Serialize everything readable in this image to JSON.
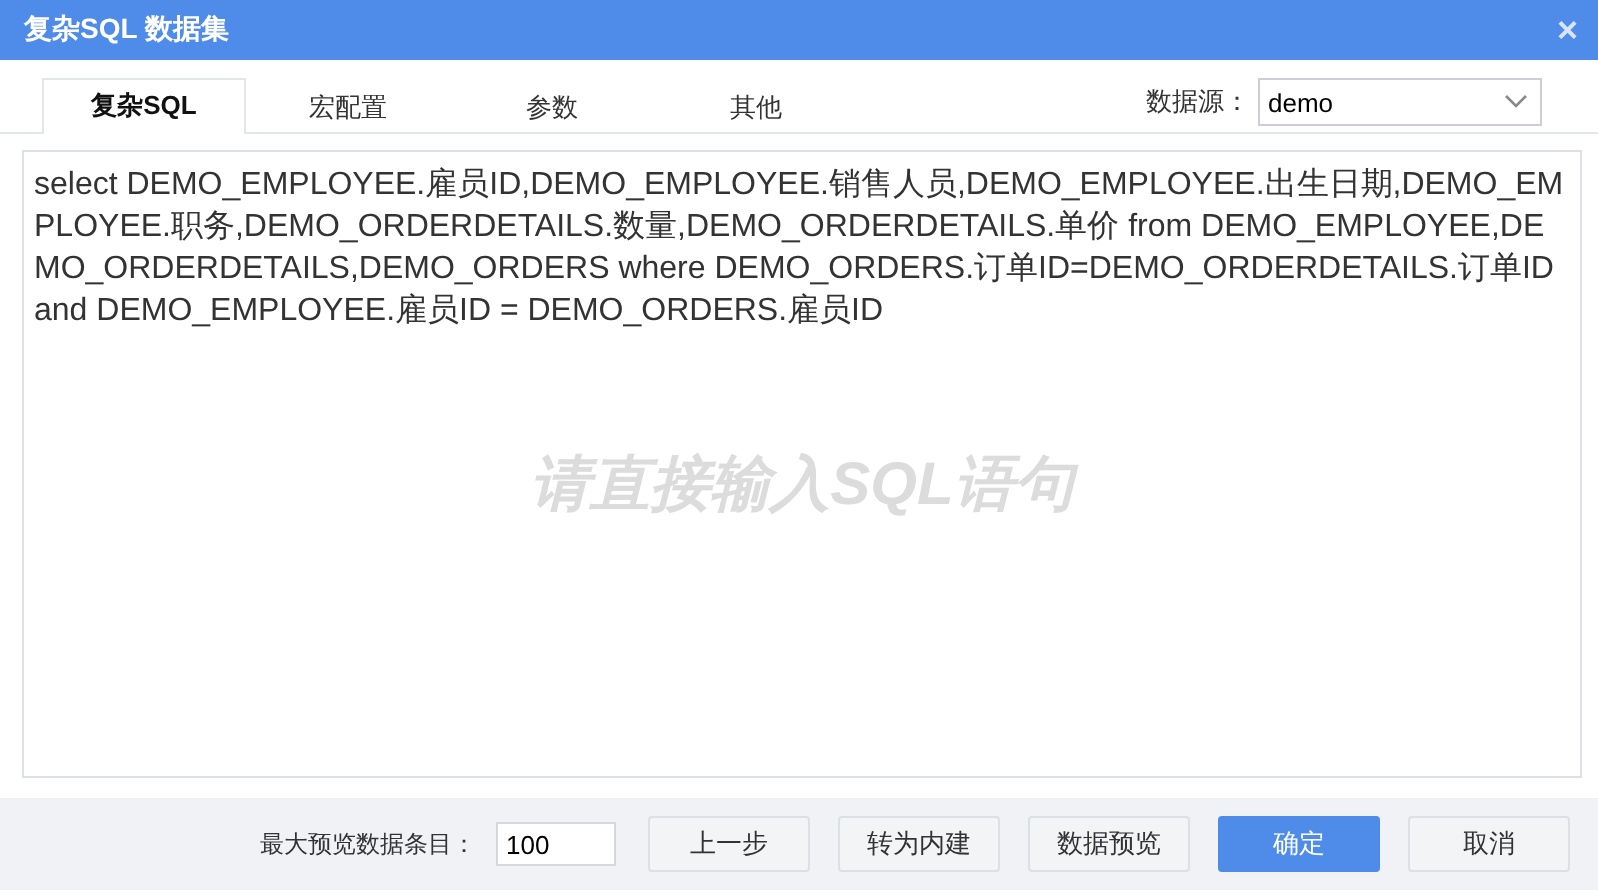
{
  "window": {
    "title": "复杂SQL 数据集",
    "close": "×"
  },
  "tabs": [
    {
      "label": "复杂SQL",
      "selected": true
    },
    {
      "label": "宏配置",
      "selected": false
    },
    {
      "label": "参数",
      "selected": false
    },
    {
      "label": "其他",
      "selected": false
    }
  ],
  "datasource": {
    "label": "数据源：",
    "value": "demo"
  },
  "editor": {
    "value": "select DEMO_EMPLOYEE.雇员ID,DEMO_EMPLOYEE.销售人员,DEMO_EMPLOYEE.出生日期,DEMO_EMPLOYEE.职务,DEMO_ORDERDETAILS.数量,DEMO_ORDERDETAILS.单价 from DEMO_EMPLOYEE,DEMO_ORDERDETAILS,DEMO_ORDERS where DEMO_ORDERS.订单ID=DEMO_ORDERDETAILS.订单ID and DEMO_EMPLOYEE.雇员ID = DEMO_ORDERS.雇员ID",
    "hint": "请直接输入SQL语句"
  },
  "footer": {
    "max_rows_label": "最大预览数据条目：",
    "max_rows_value": "100",
    "buttons": [
      {
        "label": "上一步",
        "kind": "normal"
      },
      {
        "label": "转为内建",
        "kind": "normal"
      },
      {
        "label": "数据预览",
        "kind": "normal"
      },
      {
        "label": "确定",
        "kind": "primary"
      },
      {
        "label": "取消",
        "kind": "normal"
      }
    ]
  }
}
